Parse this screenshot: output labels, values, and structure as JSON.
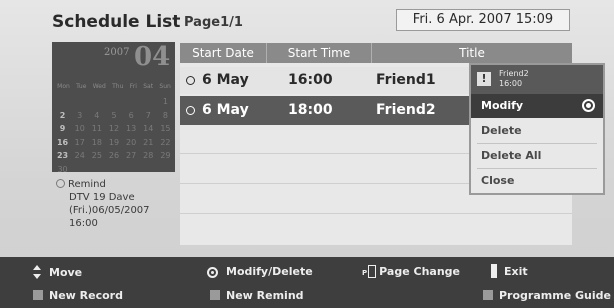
{
  "header": {
    "title": "Schedule List",
    "page": "Page1/1",
    "datetime": "Fri. 6 Apr. 2007 15:09"
  },
  "calendar": {
    "year": "2007",
    "month": "04",
    "weekdays": [
      "Mon",
      "Tue",
      "Wed",
      "Thu",
      "Fri",
      "Sat",
      "Sun"
    ],
    "weeks": [
      [
        "",
        "",
        "",
        "",
        "",
        "",
        "1"
      ],
      [
        "2",
        "3",
        "4",
        "5",
        "6",
        "7",
        "8"
      ],
      [
        "9",
        "10",
        "11",
        "12",
        "13",
        "14",
        "15"
      ],
      [
        "16",
        "17",
        "18",
        "19",
        "20",
        "21",
        "22"
      ],
      [
        "23",
        "24",
        "25",
        "26",
        "27",
        "28",
        "29"
      ],
      [
        "30",
        "",
        "",
        "",
        "",
        "",
        ""
      ]
    ]
  },
  "remind": {
    "label": "Remind",
    "line1": "DTV 19 Dave",
    "line2": "(Fri.)06/05/2007",
    "line3": "16:00"
  },
  "list": {
    "columns": [
      "Start Date",
      "Start Time",
      "Title"
    ],
    "rows": [
      {
        "date": "6 May",
        "time": "16:00",
        "title": "Friend1"
      },
      {
        "date": "6 May",
        "time": "18:00",
        "title": "Friend2"
      }
    ]
  },
  "popup": {
    "title": "Friend2",
    "time": "16:00",
    "items": [
      "Modify",
      "Delete",
      "Delete All",
      "Close"
    ]
  },
  "footer": {
    "move": "Move",
    "modify_delete": "Modify/Delete",
    "page_change": "Page Change",
    "exit": "Exit",
    "new_record": "New Record",
    "new_remind": "New Remind",
    "programme_guide": "Programme Guide"
  }
}
